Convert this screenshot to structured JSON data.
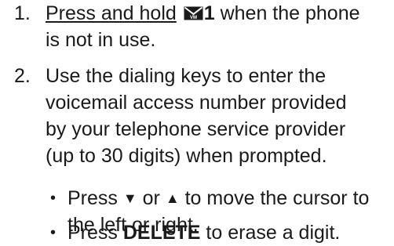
{
  "steps": [
    {
      "number": "1.",
      "action": "Press and hold",
      "key": "1",
      "icon": "voicemail-key-icon",
      "rest": " when the phone",
      "line2": "is not in use."
    },
    {
      "number": "2.",
      "lines": [
        "Use the dialing keys to enter the",
        "voicemail access number provided",
        "by your telephone service provider",
        "(up to 30 digits) when prompted."
      ]
    }
  ],
  "bullets": [
    {
      "marker": "•",
      "press": "Press ",
      "down_arrow": "▼",
      "or": " or ",
      "up_arrow": "▲",
      "rest": " to move the cursor to",
      "line2": "the left or right."
    },
    {
      "marker": "•",
      "press": "Press ",
      "key": "DELETE",
      "rest": " to erase a digit."
    }
  ]
}
